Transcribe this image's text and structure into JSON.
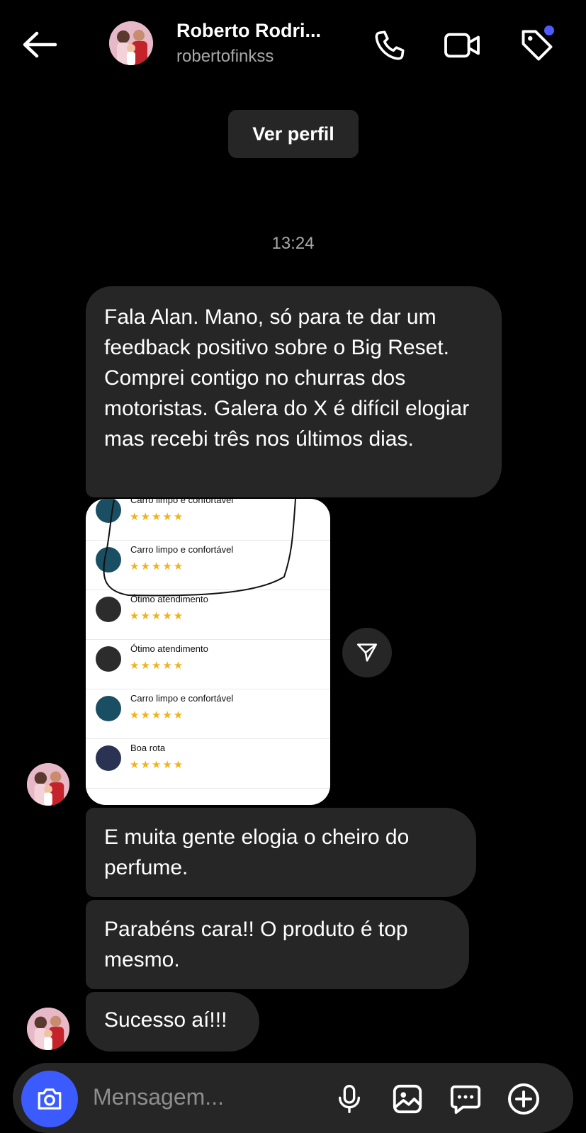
{
  "header": {
    "name": "Roberto Rodri...",
    "username": "robertofinkss"
  },
  "profile_button": "Ver perfil",
  "timestamp": "13:24",
  "messages": [
    "Fala Alan. Mano, só para te dar um feedback positivo sobre o Big Reset. Comprei contigo no churras dos motoristas. Galera do X é difícil elogiar mas recebi três nos últimos dias.",
    "E muita gente elogia o cheiro do perfume.",
    "Parabéns cara!! O produto é top mesmo.",
    "Sucesso aí!!!"
  ],
  "screenshot_reviews": [
    {
      "label": "Carro limpo e confortável",
      "stars": "★★★★★",
      "icon": "car-clean-icon"
    },
    {
      "label": "Carro limpo e confortável",
      "stars": "★★★★★",
      "icon": "car-clean-icon"
    },
    {
      "label": "Ótimo atendimento",
      "stars": "★★★★★",
      "icon": "thumbs-up-icon"
    },
    {
      "label": "Ótimo atendimento",
      "stars": "★★★★★",
      "icon": "thumbs-up-icon"
    },
    {
      "label": "Carro limpo e confortável",
      "stars": "★★★★★",
      "icon": "car-clean-icon"
    },
    {
      "label": "Boa rota",
      "stars": "★★★★★",
      "icon": "route-pin-icon"
    }
  ],
  "composer": {
    "placeholder": "Mensagem..."
  },
  "colors": {
    "background": "#000000",
    "bubble": "#262626",
    "camera_button": "#3b5bff",
    "notification_dot": "#4f5bff",
    "stars": "#f2b21c"
  }
}
